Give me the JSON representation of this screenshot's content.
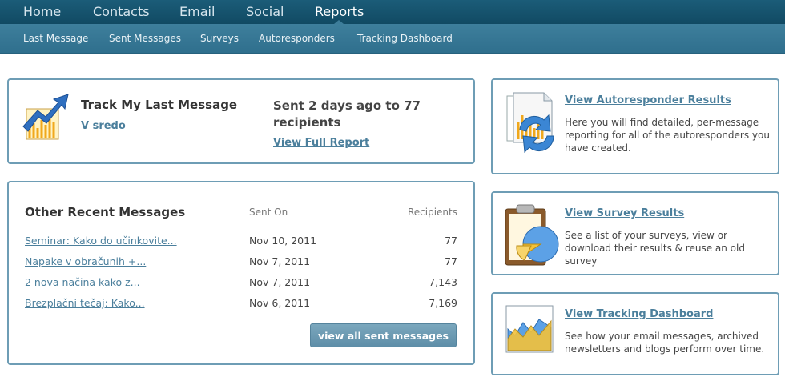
{
  "topnav": {
    "items": [
      {
        "label": "Home"
      },
      {
        "label": "Contacts"
      },
      {
        "label": "Email"
      },
      {
        "label": "Social"
      },
      {
        "label": "Reports",
        "active": true
      }
    ]
  },
  "subnav": {
    "items": [
      {
        "label": "Last Message"
      },
      {
        "label": "Sent Messages"
      },
      {
        "label": "Surveys"
      },
      {
        "label": "Autoresponders"
      },
      {
        "label": "Tracking Dashboard"
      }
    ]
  },
  "last_message": {
    "icon": "chart-up-arrow-icon",
    "title": "Track My Last Message",
    "name_link": "V sredo",
    "sent_info": "Sent 2 days ago to 77 recipients",
    "full_report_link": "View Full Report"
  },
  "recent": {
    "title": "Other Recent Messages",
    "col_sent": "Sent On",
    "col_recipients": "Recipients",
    "rows": [
      {
        "subject": "Seminar: Kako do učinkovite...",
        "date": "Nov 10, 2011",
        "recipients": "77"
      },
      {
        "subject": "Napake v obračunih +...",
        "date": "Nov 7, 2011",
        "recipients": "77"
      },
      {
        "subject": "2 nova načina kako z...",
        "date": "Nov 7, 2011",
        "recipients": "7,143"
      },
      {
        "subject": "Brezplačni tečaj: Kako...",
        "date": "Nov 6, 2011",
        "recipients": "7,169"
      }
    ],
    "button": "view all sent messages"
  },
  "right_panels": {
    "autoresponder": {
      "icon": "autoresponder-report-icon",
      "title": "View Autoresponder Results",
      "desc": "Here you will find detailed, per-message reporting for all of the autoresponders you have created."
    },
    "survey": {
      "icon": "clipboard-pie-chart-icon",
      "title": "View Survey Results",
      "desc": "See a list of your surveys, view or download their results & reuse an old survey"
    },
    "tracking": {
      "icon": "area-chart-icon",
      "title": "View Tracking Dashboard",
      "desc": "See how your email messages, archived newsletters and blogs perform over time."
    }
  },
  "colors": {
    "topnav": "#114a63",
    "subnav": "#3e7f9c",
    "panel_border": "#6e9db5",
    "link": "#4b7f9c",
    "button": "#6c9bb3"
  }
}
